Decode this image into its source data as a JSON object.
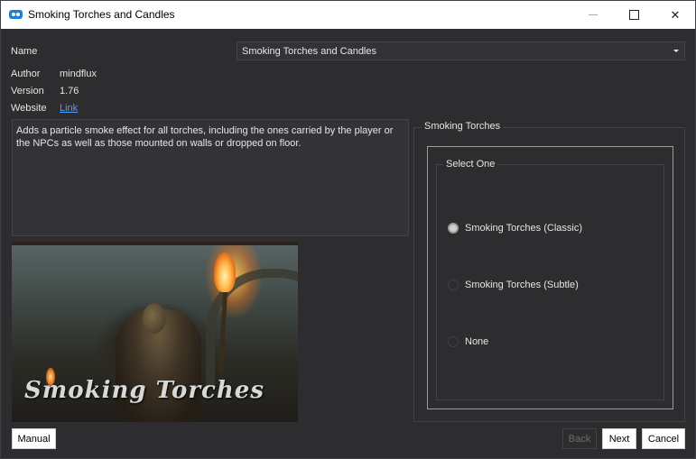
{
  "window": {
    "title": "Smoking Torches and Candles",
    "controls": {
      "minimize_icon": "minimize-icon",
      "maximize_icon": "maximize-icon",
      "close_icon": "close-icon",
      "close_glyph": "✕"
    }
  },
  "fields": {
    "name_label": "Name",
    "name_value": "Smoking Torches and Candles",
    "author_label": "Author",
    "author_value": "mindflux",
    "version_label": "Version",
    "version_value": "1.76",
    "website_label": "Website",
    "website_value": "Link"
  },
  "description": "Adds a particle smoke effect for all torches, including the ones carried by the player or the NPCs as well as those mounted on walls or dropped on floor.",
  "image": {
    "brand_text": "Smoking Torches"
  },
  "options_group": {
    "title": "Smoking Torches",
    "select_title": "Select One",
    "options": [
      {
        "label": "Smoking Torches (Classic)",
        "selected": true
      },
      {
        "label": "Smoking Torches (Subtle)",
        "selected": false
      },
      {
        "label": "None",
        "selected": false
      }
    ]
  },
  "buttons": {
    "manual": "Manual",
    "back": "Back",
    "next": "Next",
    "cancel": "Cancel"
  }
}
